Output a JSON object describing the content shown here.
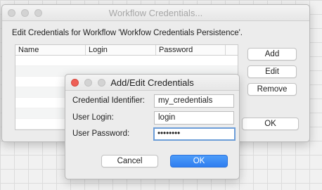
{
  "main_window": {
    "title": "Workflow Credentials...",
    "description": "Edit Credentials for Workflow 'Workfow Credentials Persistence'.",
    "table": {
      "columns": [
        "Name",
        "Login",
        "Password"
      ],
      "rows": []
    },
    "buttons": {
      "add": "Add",
      "edit": "Edit",
      "remove": "Remove",
      "ok": "OK"
    }
  },
  "dialog": {
    "title": "Add/Edit Credentials",
    "fields": {
      "identifier": {
        "label": "Credential Identifier:",
        "value": "my_credentials"
      },
      "login": {
        "label": "User Login:",
        "value": "login"
      },
      "password": {
        "label": "User Password:",
        "value": "••••••••"
      }
    },
    "buttons": {
      "cancel": "Cancel",
      "ok": "OK"
    }
  }
}
